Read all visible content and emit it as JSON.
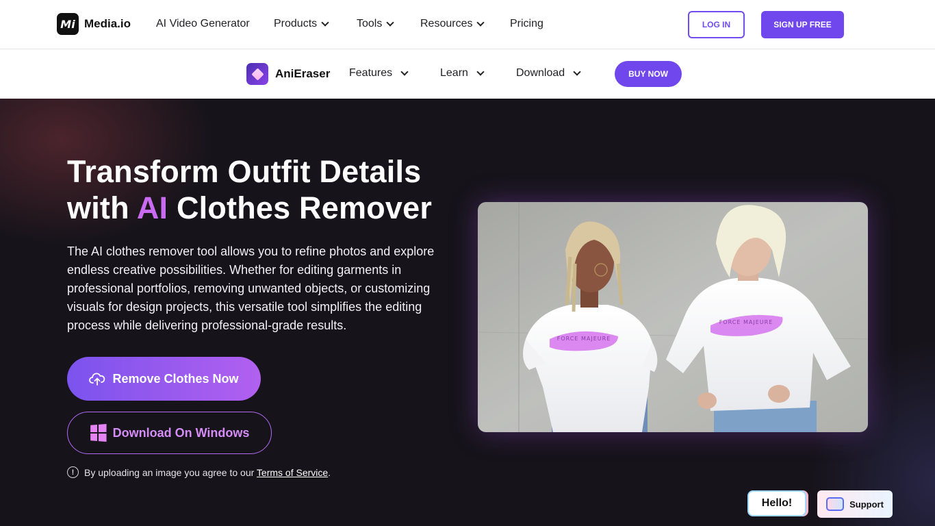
{
  "topnav": {
    "logo_text": "Media.io",
    "logo_mark": "Mi",
    "items": [
      {
        "label": "AI Video Generator"
      },
      {
        "label": "Products"
      },
      {
        "label": "Tools"
      },
      {
        "label": "Resources"
      },
      {
        "label": "Pricing"
      }
    ],
    "login": "LOG IN",
    "signup": "SIGN UP FREE"
  },
  "subnav": {
    "app_name": "AniEraser",
    "items": [
      {
        "label": "Features"
      },
      {
        "label": "Learn"
      },
      {
        "label": "Download"
      }
    ],
    "buy": "BUY NOW"
  },
  "hero": {
    "headline_line1": "Transform Outfit Details",
    "headline_with": "with",
    "headline_ai": "AI",
    "headline_rest": "Clothes Remover",
    "description": "The AI clothes remover tool allows you to refine photos and explore endless creative possibilities. Whether for editing garments in professional portfolios, removing unwanted objects, or customizing visuals for design projects, this versatile tool simplifies the editing process while delivering professional-grade results.",
    "primary_button": "Remove Clothes Now",
    "secondary_button": "Download On Windows",
    "terms_text": "By uploading an image you agree to our",
    "terms_link": "Terms of Service",
    "terms_end": ".",
    "shirt_print_left": "FORCE MAJEURE",
    "shirt_print_right": "FORCE MAJEURE"
  },
  "widgets": {
    "hello": "Hello!",
    "support": "Support"
  },
  "colors": {
    "brand": "#7047ed",
    "accent_purple": "#c96bf1",
    "hero_bg": "#16131a"
  }
}
